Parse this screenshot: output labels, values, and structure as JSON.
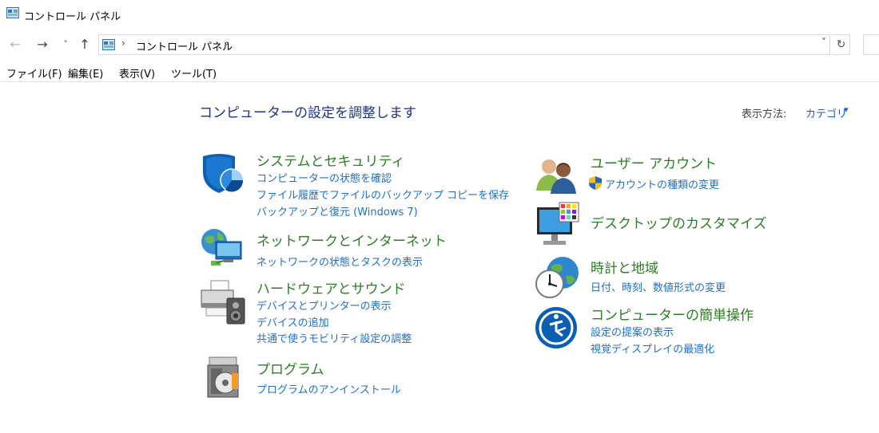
{
  "window": {
    "title": "コントロール パネル"
  },
  "address": {
    "breadcrumb": "コントロール パネル",
    "separator": "›"
  },
  "nav": {
    "back": "←",
    "forward": "→",
    "recent": "˅",
    "up": "↑",
    "dropdown": "˅",
    "refresh": "↻"
  },
  "menu": [
    "ファイル(F)",
    "編集(E)",
    "表示(V)",
    "ツール(T)"
  ],
  "heading": "コンピューターの設定を調整します",
  "view": {
    "label": "表示方法:",
    "value": "カテゴリ",
    "arrow": "▾"
  },
  "categories": {
    "system": {
      "title": "システムとセキュリティ",
      "links": [
        "コンピューターの状態を確認",
        "ファイル履歴でファイルのバックアップ コピーを保存",
        "バックアップと復元 (Windows 7)"
      ],
      "icon": "shield-icon"
    },
    "network": {
      "title": "ネットワークとインターネット",
      "links": [
        "ネットワークの状態とタスクの表示"
      ],
      "icon": "network-globe-icon"
    },
    "hardware": {
      "title": "ハードウェアとサウンド",
      "links": [
        "デバイスとプリンターの表示",
        "デバイスの追加",
        "共通で使うモビリティ設定の調整"
      ],
      "icon": "printer-speaker-icon"
    },
    "programs": {
      "title": "プログラム",
      "links": [
        "プログラムのアンインストール"
      ],
      "icon": "programs-disc-icon"
    },
    "users": {
      "title": "ユーザー アカウント",
      "links": [
        "アカウントの種類の変更"
      ],
      "icon": "users-icon"
    },
    "appearance": {
      "title": "デスクトップのカスタマイズ",
      "links": [],
      "icon": "monitor-palette-icon"
    },
    "clock": {
      "title": "時計と地域",
      "links": [
        "日付、時刻、数値形式の変更"
      ],
      "icon": "clock-globe-icon"
    },
    "ease": {
      "title": "コンピューターの簡単操作",
      "links": [
        "設定の提案の表示",
        "視覚ディスプレイの最適化"
      ],
      "icon": "ease-of-access-icon"
    }
  },
  "colors": {
    "heading": "#1e3287",
    "category_title": "#2a7e23",
    "link": "#1f6fc5"
  }
}
